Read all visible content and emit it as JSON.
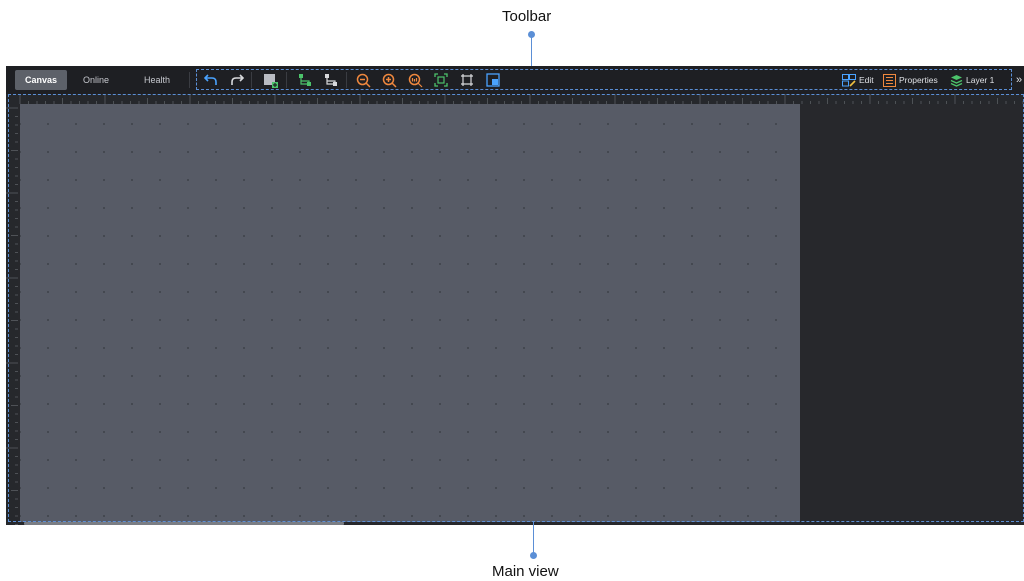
{
  "callouts": {
    "toolbar": "Toolbar",
    "main_view": "Main view"
  },
  "tabs": [
    "Canvas",
    "Online",
    "Health"
  ],
  "active_tab": "Canvas",
  "toolbar": {
    "tools": [
      "undo-icon",
      "redo-icon",
      "add-shape-icon",
      "connect-icon",
      "connect-alt-icon",
      "zoom-out-icon",
      "zoom-in-icon",
      "zoom-actual-icon",
      "fit-to-screen-icon",
      "fit-width-icon",
      "overview-icon"
    ],
    "edit_label": "Edit",
    "properties_label": "Properties",
    "layer_label": "Layer 1",
    "more": "»"
  },
  "colors": {
    "accent": "#5b8fd6",
    "undo": "#4aa3ff",
    "add": "#4cc36b",
    "zoom": "#f0883e",
    "page": "#575b66",
    "workspace": "#27282c"
  }
}
